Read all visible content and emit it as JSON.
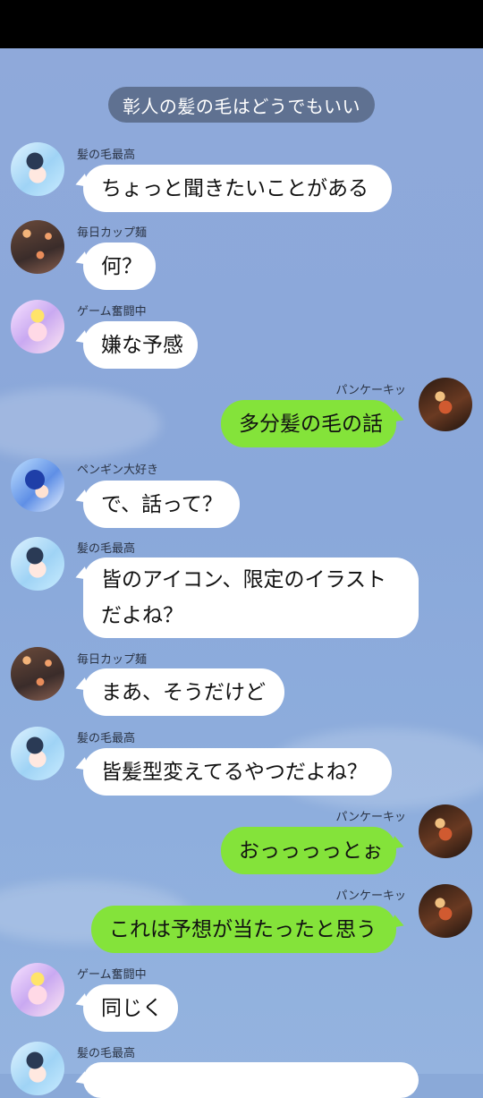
{
  "chat": {
    "title": "彰人の髪の毛はどうでもいい",
    "messages": [
      {
        "sender": "髪の毛最高",
        "text": "ちょっと聞きたいことがある"
      },
      {
        "sender": "毎日カップ麺",
        "text": "何？"
      },
      {
        "sender": "ゲーム奮闘中",
        "text": "嫌な予感"
      },
      {
        "sender": "パンケーキッ",
        "text": "多分髪の毛の話"
      },
      {
        "sender": "ペンギン大好き",
        "text": "で、話って？"
      },
      {
        "sender": "髪の毛最高",
        "text": "皆のアイコン、限定のイラストだよね？"
      },
      {
        "sender": "毎日カップ麺",
        "text": "まあ、そうだけど"
      },
      {
        "sender": "髪の毛最高",
        "text": "皆髪型変えてるやつだよね？"
      },
      {
        "sender": "パンケーキッ",
        "text": "おっっっっとぉ"
      },
      {
        "sender": "パンケーキッ",
        "text": "これは予想が当たったと思う"
      },
      {
        "sender": "ゲーム奮闘中",
        "text": "同じく"
      },
      {
        "sender": "髪の毛最高",
        "text": ""
      }
    ]
  },
  "colors": {
    "background": "#8aa9d8",
    "incoming_bubble": "#ffffff",
    "outgoing_bubble": "#84e33a",
    "header_pill": "#5f7191"
  }
}
